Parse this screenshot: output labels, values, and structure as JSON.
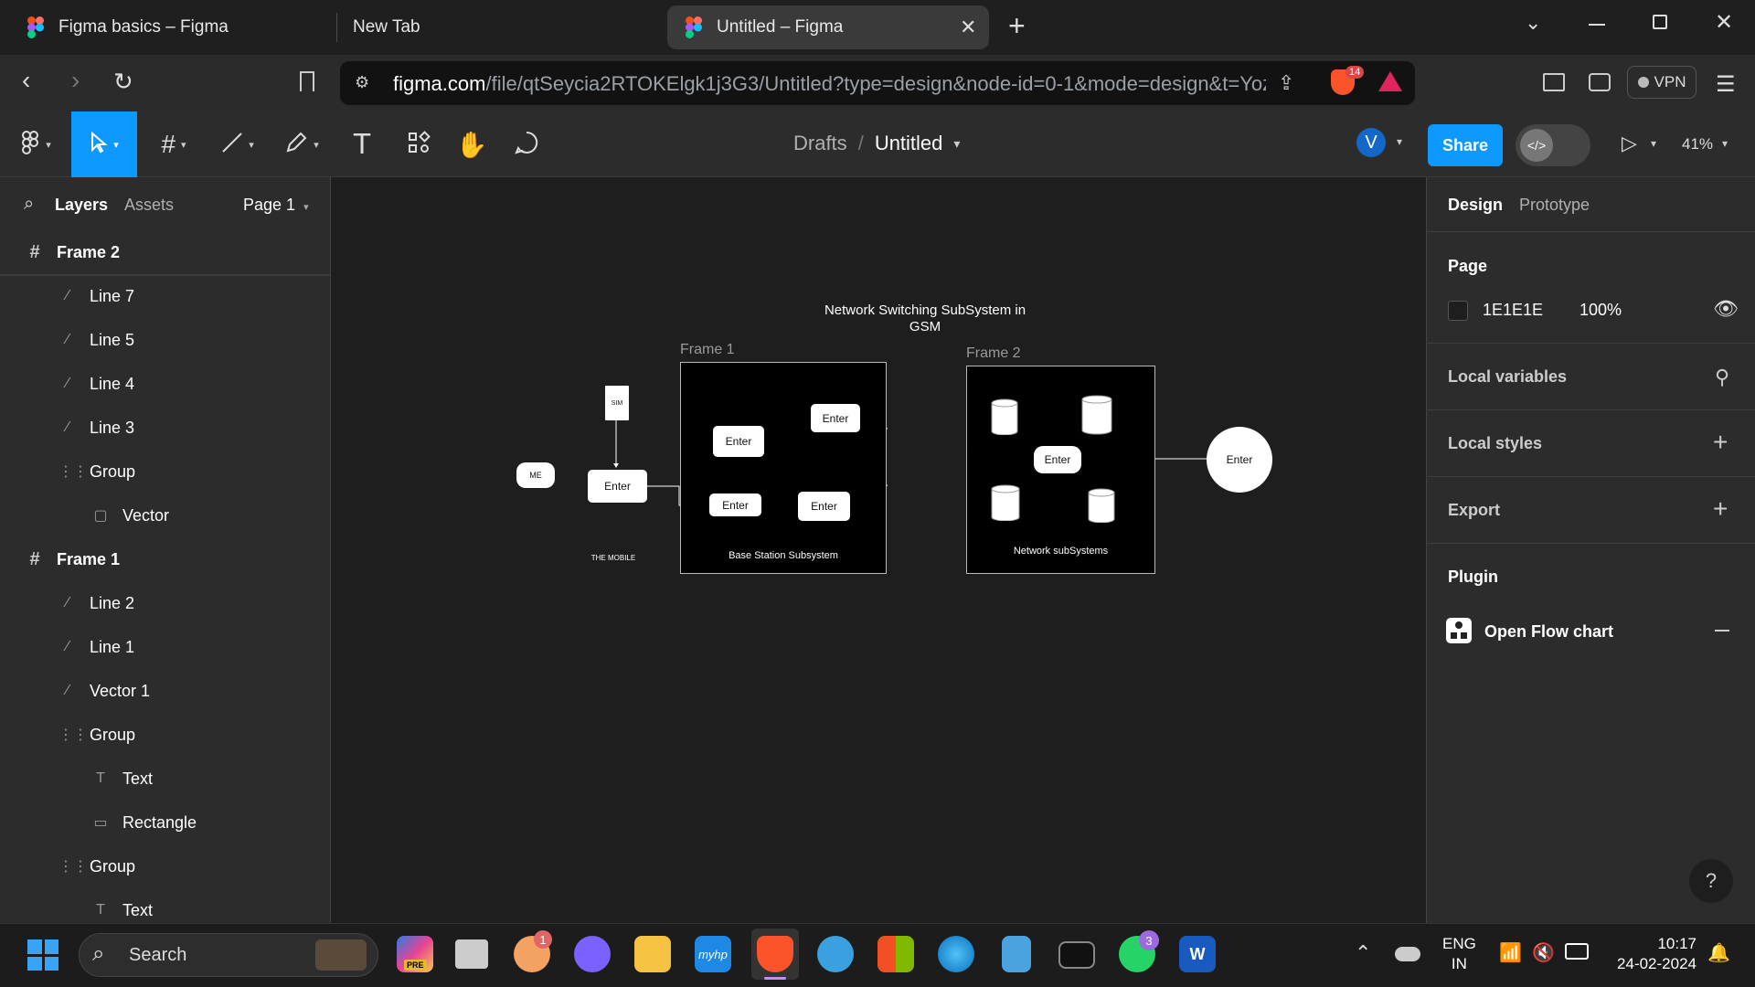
{
  "browser": {
    "tabs": [
      {
        "title": "Figma basics – Figma",
        "active": false
      },
      {
        "title": "New Tab",
        "active": false
      },
      {
        "title": "Untitled – Figma",
        "active": true
      }
    ],
    "url_domain": "figma.com",
    "url_path": "/file/qtSeycia2RTOKElgk1j3G3/Untitled?type=design&node-id=0-1&mode=design&t=Yoz...",
    "brave_badge": "14",
    "vpn_label": "VPN"
  },
  "figma": {
    "breadcrumb_root": "Drafts",
    "breadcrumb_sep": "/",
    "file_name": "Untitled",
    "avatar_initial": "V",
    "share_label": "Share",
    "zoom": "41%",
    "accent": "#0d99ff"
  },
  "left_panel": {
    "tab_layers": "Layers",
    "tab_assets": "Assets",
    "page_selector": "Page 1",
    "layers": [
      {
        "name": "Frame 2",
        "type": "frame",
        "level": 0
      },
      {
        "name": "Line 7",
        "type": "line",
        "level": 1
      },
      {
        "name": "Line 5",
        "type": "line",
        "level": 1
      },
      {
        "name": "Line 4",
        "type": "line",
        "level": 1
      },
      {
        "name": "Line 3",
        "type": "line",
        "level": 1
      },
      {
        "name": "Group",
        "type": "group",
        "level": 1
      },
      {
        "name": "Vector",
        "type": "vector",
        "level": 2
      },
      {
        "name": "Frame 1",
        "type": "frame",
        "level": 0
      },
      {
        "name": "Line 2",
        "type": "line",
        "level": 1
      },
      {
        "name": "Line 1",
        "type": "line",
        "level": 1
      },
      {
        "name": "Vector 1",
        "type": "line",
        "level": 1
      },
      {
        "name": "Group",
        "type": "group",
        "level": 1
      },
      {
        "name": "Text",
        "type": "text",
        "level": 2
      },
      {
        "name": "Rectangle",
        "type": "rect",
        "level": 2
      },
      {
        "name": "Group",
        "type": "group",
        "level": 1
      },
      {
        "name": "Text",
        "type": "text",
        "level": 2
      }
    ]
  },
  "right_panel": {
    "tab_design": "Design",
    "tab_prototype": "Prototype",
    "page_title": "Page",
    "page_color": "1E1E1E",
    "page_opacity": "100%",
    "local_variables": "Local variables",
    "local_styles": "Local styles",
    "export": "Export",
    "plugin_title": "Plugin",
    "plugin_item": "Open Flow chart",
    "help": "?"
  },
  "canvas": {
    "title_line1": "Network Switching  SubSystem in",
    "title_line2": "GSM",
    "frame1_label": "Frame 1",
    "frame2_label": "Frame 2",
    "sim": "SIM",
    "me": "ME",
    "enter": "Enter",
    "the_mobile": "THE MOBILE",
    "bss_caption": "Base Station Subsystem",
    "nss_caption": "Network subSystems"
  },
  "taskbar": {
    "search": "Search",
    "lang_top": "ENG",
    "lang_bottom": "IN",
    "time": "10:17",
    "date": "24-02-2024",
    "badge_1": "1",
    "badge_3": "3",
    "pre": "PRE"
  }
}
